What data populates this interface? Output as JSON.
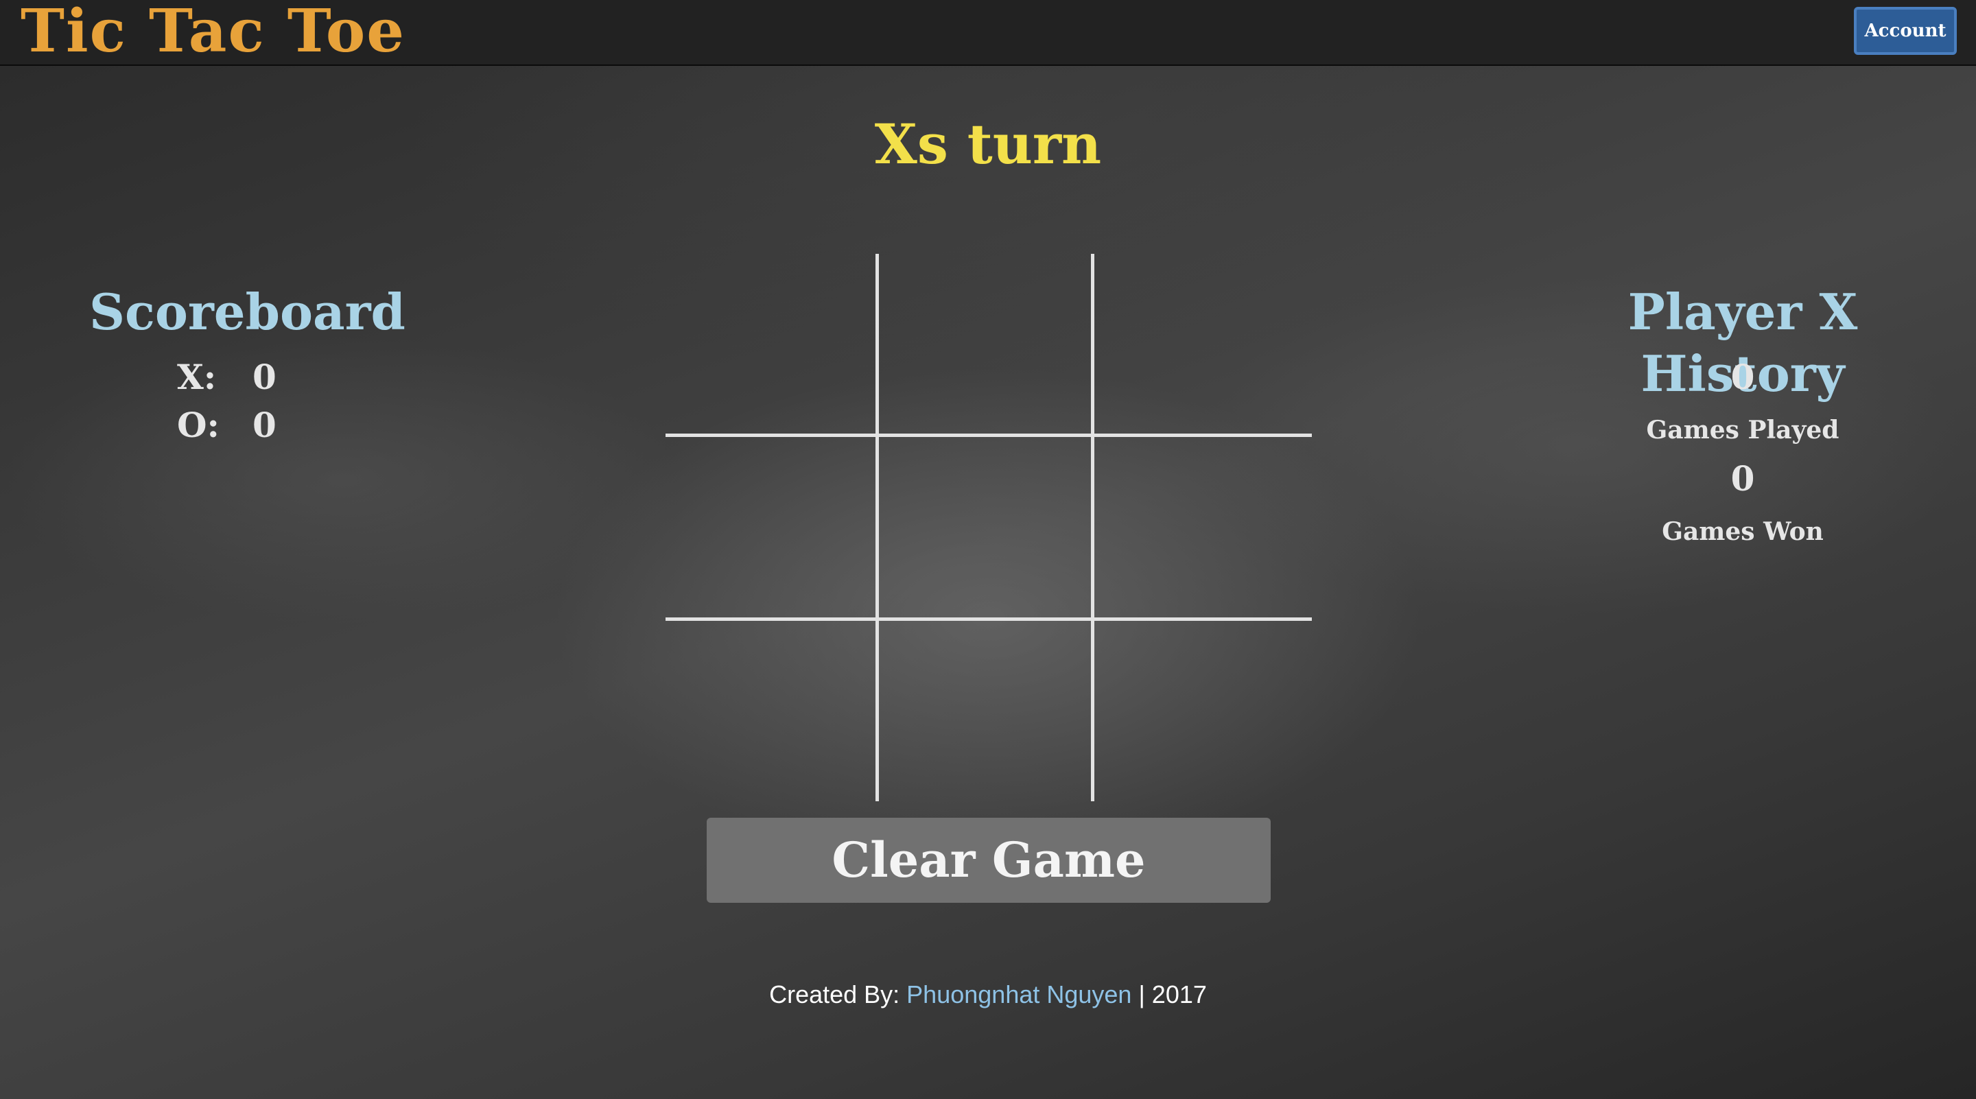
{
  "header": {
    "brand": "Tic Tac Toe",
    "account_label": "Account"
  },
  "status": {
    "turn": "Xs turn"
  },
  "scoreboard": {
    "title": "Scoreboard",
    "rows": [
      {
        "label": "X:",
        "value": "0"
      },
      {
        "label": "O:",
        "value": "0"
      }
    ]
  },
  "history": {
    "title": "Player X History",
    "games_played": "0",
    "games_played_label": "Games Played",
    "games_won": "0",
    "games_won_label": "Games Won"
  },
  "board": {
    "cells": [
      "",
      "",
      "",
      "",
      "",
      "",
      "",
      "",
      ""
    ]
  },
  "actions": {
    "clear_label": "Clear Game"
  },
  "footer": {
    "prefix": "Created By: ",
    "author": "Phuongnhat Nguyen",
    "suffix": " | 2017"
  },
  "colors": {
    "brand": "#e8a23a",
    "turn": "#f3e04a",
    "heading": "#a9d3e6",
    "account_button": "#2d5d97",
    "link": "#8ec2e6",
    "clear_button": "#717171"
  }
}
